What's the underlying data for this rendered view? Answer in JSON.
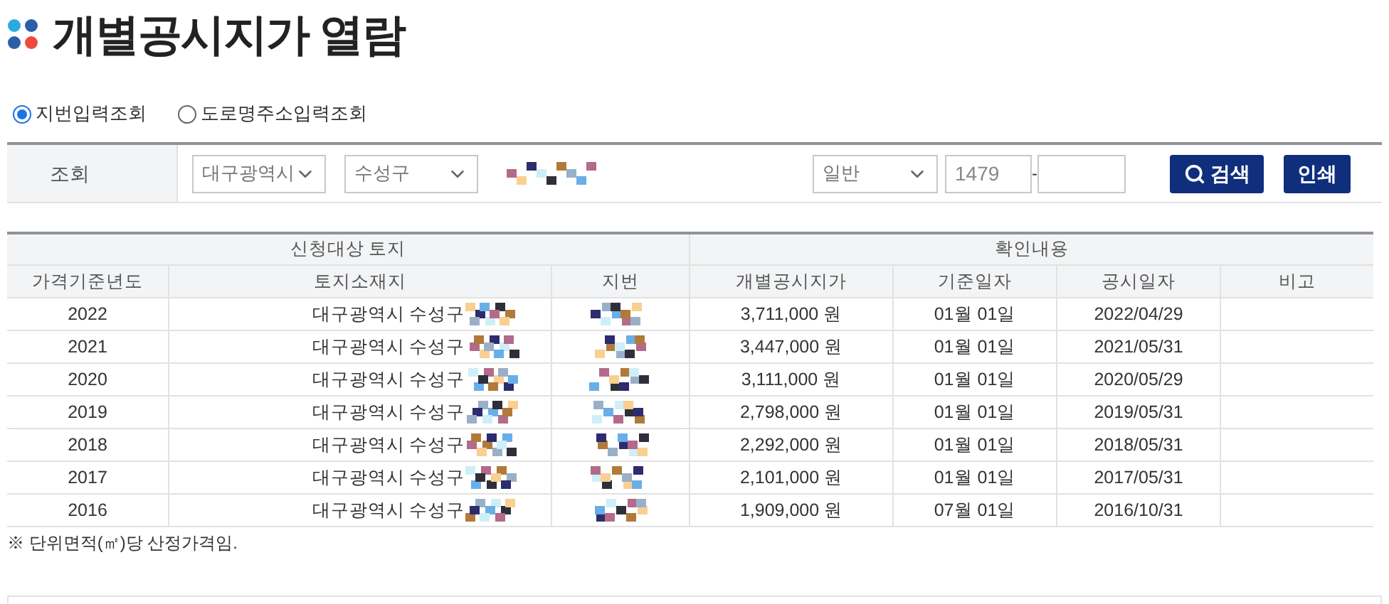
{
  "title": "개별공시지가 열람",
  "search_modes": [
    {
      "label": "지번입력조회",
      "selected": true
    },
    {
      "label": "도로명주소입력조회",
      "selected": false
    }
  ],
  "search": {
    "label": "조회",
    "city": "대구광역시",
    "district": "수성구",
    "land_type": "일반",
    "main_number": "1479",
    "separator": "-",
    "search_button": "검색",
    "print_button": "인쇄"
  },
  "table": {
    "group_headers": [
      "신청대상 토지",
      "확인내용"
    ],
    "columns": [
      "가격기준년도",
      "토지소재지",
      "지번",
      "개별공시지가",
      "기준일자",
      "공시일자",
      "비고"
    ],
    "rows": [
      {
        "year": "2022",
        "address": "대구광역시 수성구",
        "price": "3,711,000 원",
        "base_date": "01월 01일",
        "published": "2022/04/29"
      },
      {
        "year": "2021",
        "address": "대구광역시 수성구",
        "price": "3,447,000 원",
        "base_date": "01월 01일",
        "published": "2021/05/31"
      },
      {
        "year": "2020",
        "address": "대구광역시 수성구",
        "price": "3,111,000 원",
        "base_date": "01월 01일",
        "published": "2020/05/29"
      },
      {
        "year": "2019",
        "address": "대구광역시 수성구",
        "price": "2,798,000 원",
        "base_date": "01월 01일",
        "published": "2019/05/31"
      },
      {
        "year": "2018",
        "address": "대구광역시 수성구",
        "price": "2,292,000 원",
        "base_date": "01월 01일",
        "published": "2018/05/31"
      },
      {
        "year": "2017",
        "address": "대구광역시 수성구",
        "price": "2,101,000 원",
        "base_date": "01월 01일",
        "published": "2017/05/31"
      },
      {
        "year": "2016",
        "address": "대구광역시 수성구",
        "price": "1,909,000 원",
        "base_date": "07월 01일",
        "published": "2016/10/31"
      }
    ]
  },
  "footnote": "※ 단위면적(㎡)당 산정가격임."
}
